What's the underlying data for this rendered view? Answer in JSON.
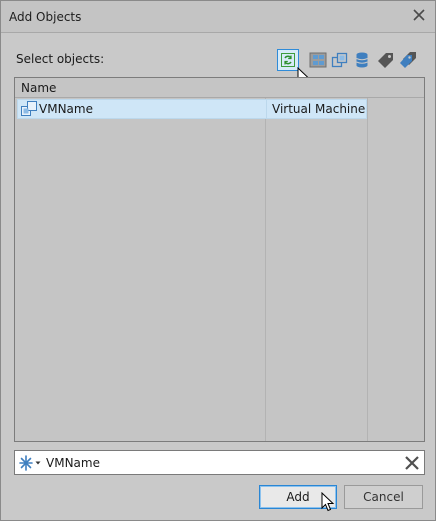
{
  "window": {
    "title": "Add Objects"
  },
  "picker": {
    "label": "Select objects:"
  },
  "list": {
    "columns": [
      "Name"
    ],
    "rows": [
      {
        "name": "VMName",
        "type": "Virtual Machine",
        "icon": "vm-icon"
      }
    ]
  },
  "search": {
    "value": "VMName",
    "icon": "asterisk-icon"
  },
  "buttons": {
    "add": "Add",
    "cancel": "Cancel"
  },
  "colors": {
    "selection": "#cfe6f7",
    "accent": "#2a86d4"
  }
}
